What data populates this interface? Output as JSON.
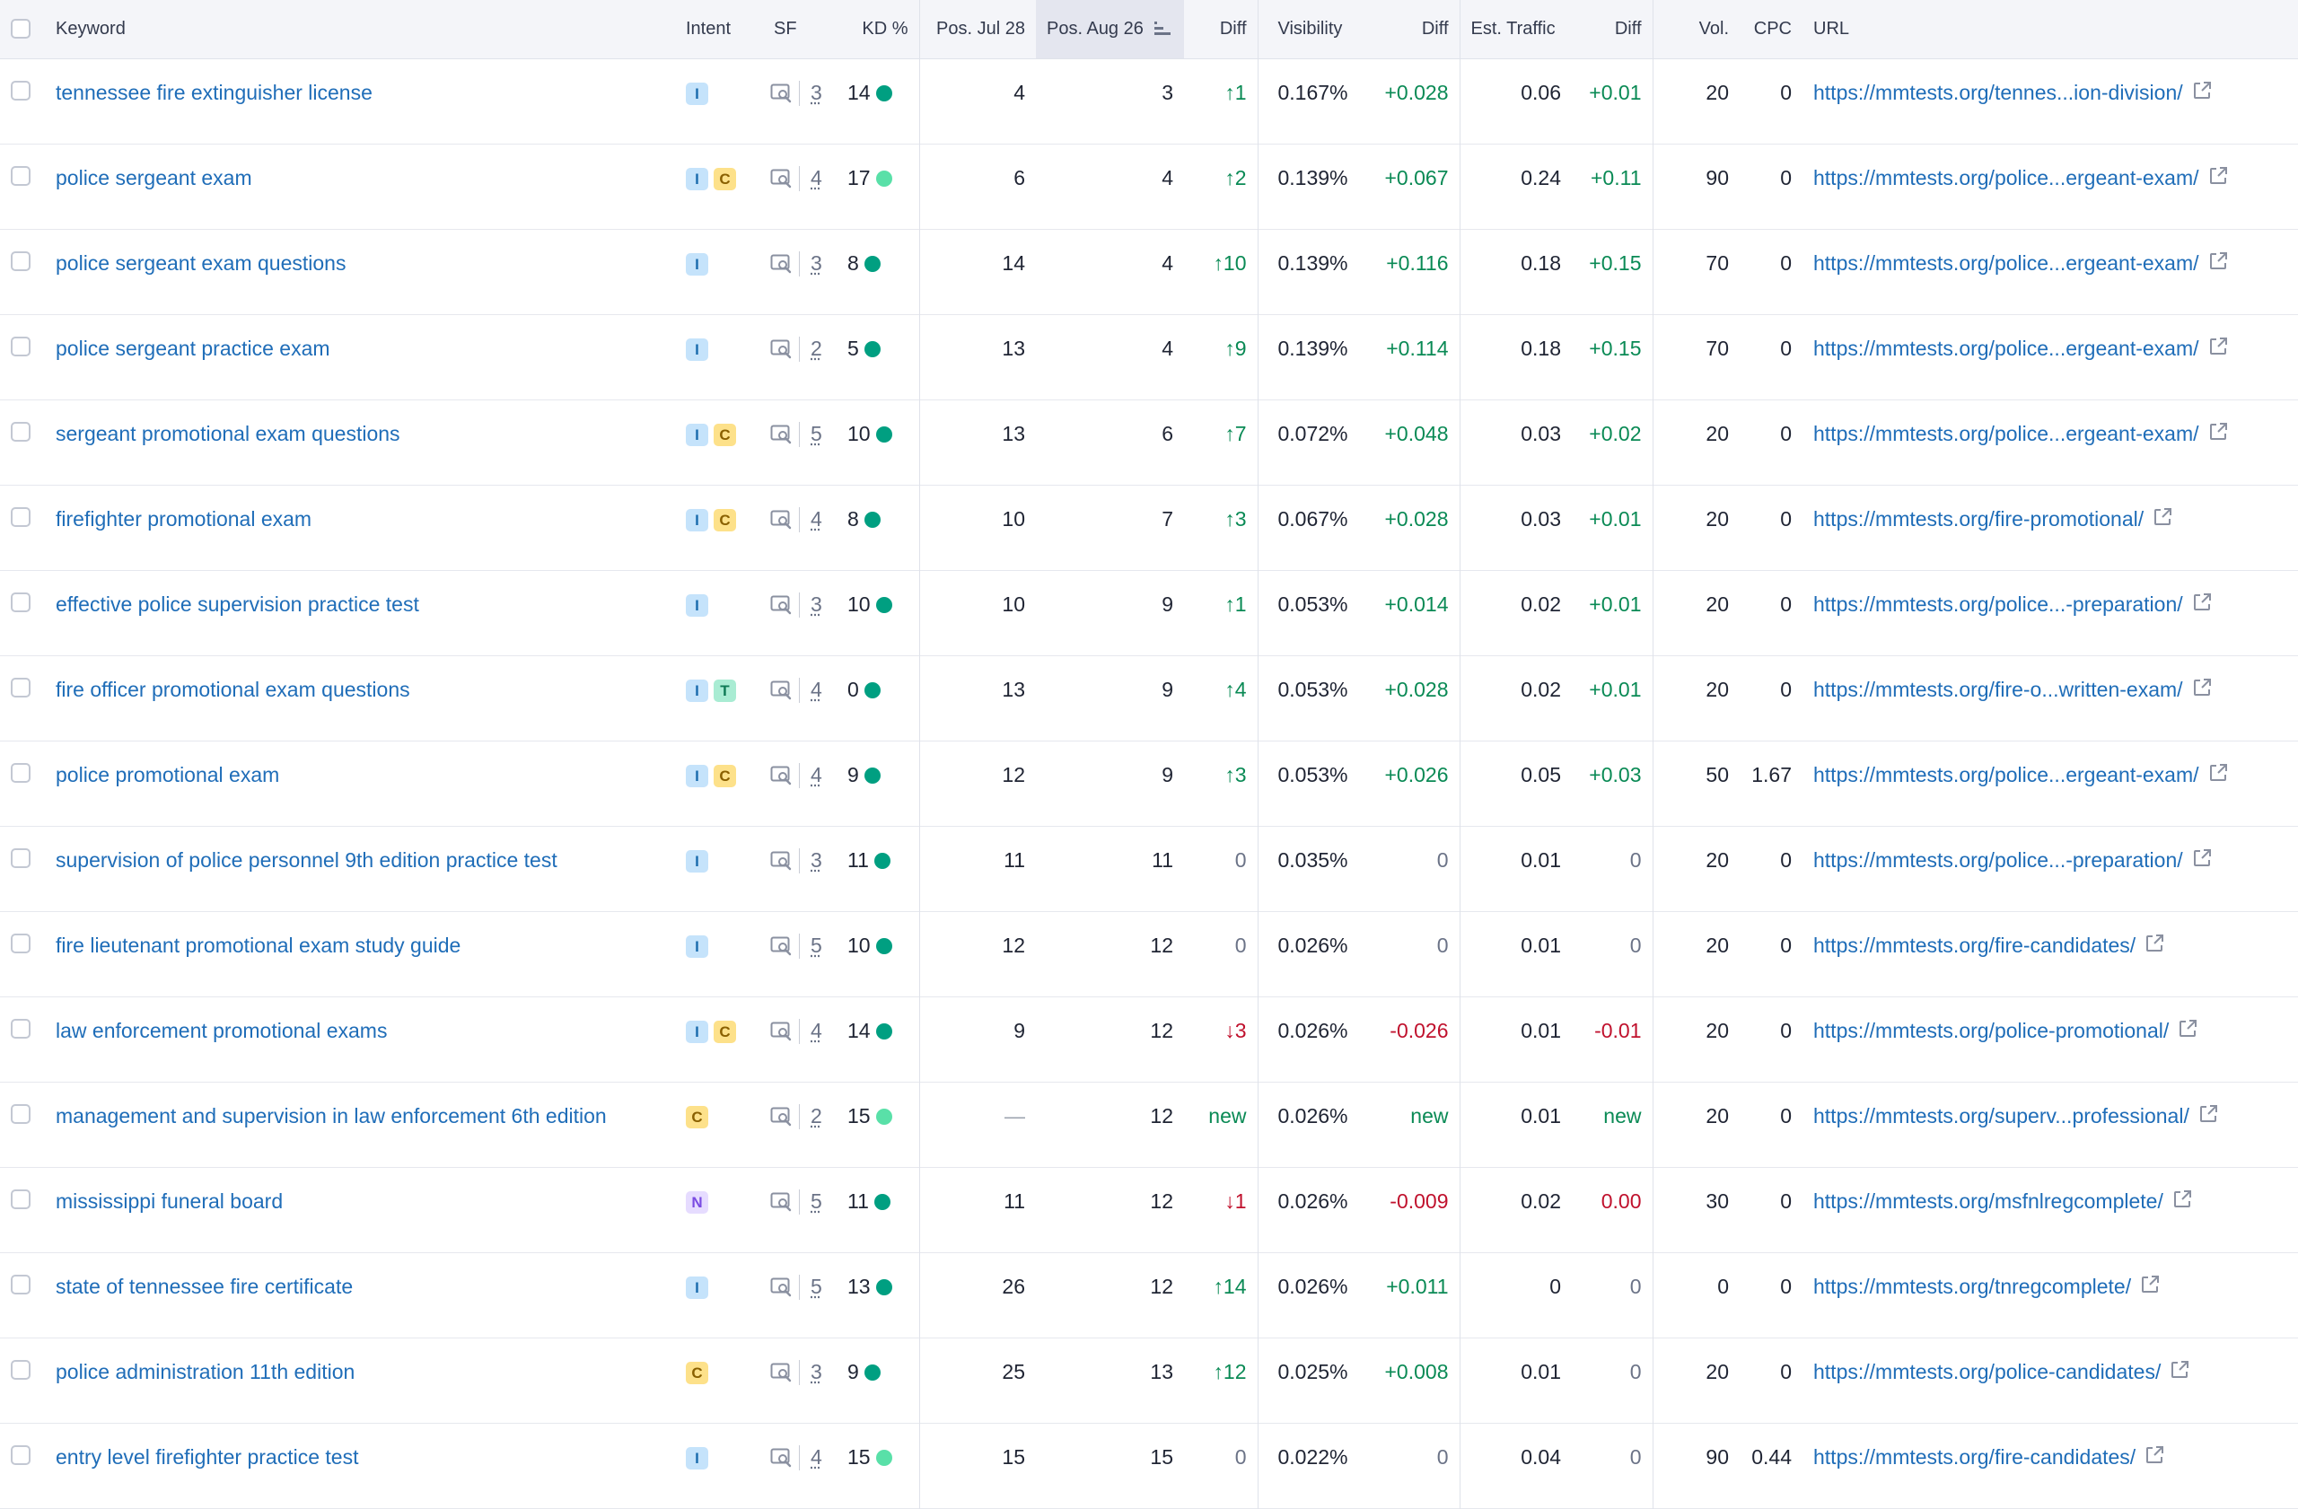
{
  "colors": {
    "link": "#1f6db8",
    "positive": "#0a8a55",
    "negative": "#c0112d",
    "kd_dark": "#009f81",
    "kd_light": "#59e0a8",
    "header_bg": "#f4f5f9"
  },
  "icons": {
    "serp_features": "serp-features-icon",
    "external_link": "external-link-icon",
    "sort": "sort-descending-icon"
  },
  "headers": {
    "keyword": "Keyword",
    "intent": "Intent",
    "sf": "SF",
    "kd": "KD %",
    "pos_prev": "Pos. Jul 28",
    "pos_curr": "Pos. Aug 26",
    "pos_diff": "Diff",
    "visibility": "Visibility",
    "vis_diff": "Diff",
    "traffic": "Est. Traffic",
    "traffic_diff": "Diff",
    "volume": "Vol.",
    "cpc": "CPC",
    "url": "URL"
  },
  "rows": [
    {
      "keyword": "tennessee fire extinguisher license",
      "intents": [
        "I"
      ],
      "sf": "3",
      "kd": "14",
      "kd_level": "dark",
      "pos_prev": "4",
      "pos_curr": "3",
      "pos_diff": "↑1",
      "pos_dir": "up",
      "vis": "0.167%",
      "vis_diff": "+0.028",
      "vis_dir": "up",
      "traffic": "0.06",
      "traffic_diff": "+0.01",
      "traffic_dir": "up",
      "vol": "20",
      "cpc": "0",
      "url": "https://mmtests.org/tennes...ion-division/"
    },
    {
      "keyword": "police sergeant exam",
      "intents": [
        "I",
        "C"
      ],
      "sf": "4",
      "kd": "17",
      "kd_level": "light",
      "pos_prev": "6",
      "pos_curr": "4",
      "pos_diff": "↑2",
      "pos_dir": "up",
      "vis": "0.139%",
      "vis_diff": "+0.067",
      "vis_dir": "up",
      "traffic": "0.24",
      "traffic_diff": "+0.11",
      "traffic_dir": "up",
      "vol": "90",
      "cpc": "0",
      "url": "https://mmtests.org/police...ergeant-exam/"
    },
    {
      "keyword": "police sergeant exam questions",
      "intents": [
        "I"
      ],
      "sf": "3",
      "kd": "8",
      "kd_level": "dark",
      "pos_prev": "14",
      "pos_curr": "4",
      "pos_diff": "↑10",
      "pos_dir": "up",
      "vis": "0.139%",
      "vis_diff": "+0.116",
      "vis_dir": "up",
      "traffic": "0.18",
      "traffic_diff": "+0.15",
      "traffic_dir": "up",
      "vol": "70",
      "cpc": "0",
      "url": "https://mmtests.org/police...ergeant-exam/"
    },
    {
      "keyword": "police sergeant practice exam",
      "intents": [
        "I"
      ],
      "sf": "2",
      "kd": "5",
      "kd_level": "dark",
      "pos_prev": "13",
      "pos_curr": "4",
      "pos_diff": "↑9",
      "pos_dir": "up",
      "vis": "0.139%",
      "vis_diff": "+0.114",
      "vis_dir": "up",
      "traffic": "0.18",
      "traffic_diff": "+0.15",
      "traffic_dir": "up",
      "vol": "70",
      "cpc": "0",
      "url": "https://mmtests.org/police...ergeant-exam/"
    },
    {
      "keyword": "sergeant promotional exam questions",
      "intents": [
        "I",
        "C"
      ],
      "sf": "5",
      "kd": "10",
      "kd_level": "dark",
      "pos_prev": "13",
      "pos_curr": "6",
      "pos_diff": "↑7",
      "pos_dir": "up",
      "vis": "0.072%",
      "vis_diff": "+0.048",
      "vis_dir": "up",
      "traffic": "0.03",
      "traffic_diff": "+0.02",
      "traffic_dir": "up",
      "vol": "20",
      "cpc": "0",
      "url": "https://mmtests.org/police...ergeant-exam/"
    },
    {
      "keyword": "firefighter promotional exam",
      "intents": [
        "I",
        "C"
      ],
      "sf": "4",
      "kd": "8",
      "kd_level": "dark",
      "pos_prev": "10",
      "pos_curr": "7",
      "pos_diff": "↑3",
      "pos_dir": "up",
      "vis": "0.067%",
      "vis_diff": "+0.028",
      "vis_dir": "up",
      "traffic": "0.03",
      "traffic_diff": "+0.01",
      "traffic_dir": "up",
      "vol": "20",
      "cpc": "0",
      "url": "https://mmtests.org/fire-promotional/"
    },
    {
      "keyword": "effective police supervision practice test",
      "intents": [
        "I"
      ],
      "sf": "3",
      "kd": "10",
      "kd_level": "dark",
      "pos_prev": "10",
      "pos_curr": "9",
      "pos_diff": "↑1",
      "pos_dir": "up",
      "vis": "0.053%",
      "vis_diff": "+0.014",
      "vis_dir": "up",
      "traffic": "0.02",
      "traffic_diff": "+0.01",
      "traffic_dir": "up",
      "vol": "20",
      "cpc": "0",
      "url": "https://mmtests.org/police...-preparation/"
    },
    {
      "keyword": "fire officer promotional exam questions",
      "intents": [
        "I",
        "T"
      ],
      "sf": "4",
      "kd": "0",
      "kd_level": "dark",
      "pos_prev": "13",
      "pos_curr": "9",
      "pos_diff": "↑4",
      "pos_dir": "up",
      "vis": "0.053%",
      "vis_diff": "+0.028",
      "vis_dir": "up",
      "traffic": "0.02",
      "traffic_diff": "+0.01",
      "traffic_dir": "up",
      "vol": "20",
      "cpc": "0",
      "url": "https://mmtests.org/fire-o...written-exam/"
    },
    {
      "keyword": "police promotional exam",
      "intents": [
        "I",
        "C"
      ],
      "sf": "4",
      "kd": "9",
      "kd_level": "dark",
      "pos_prev": "12",
      "pos_curr": "9",
      "pos_diff": "↑3",
      "pos_dir": "up",
      "vis": "0.053%",
      "vis_diff": "+0.026",
      "vis_dir": "up",
      "traffic": "0.05",
      "traffic_diff": "+0.03",
      "traffic_dir": "up",
      "vol": "50",
      "cpc": "1.67",
      "url": "https://mmtests.org/police...ergeant-exam/"
    },
    {
      "keyword": "supervision of police personnel 9th edition practice test",
      "intents": [
        "I"
      ],
      "sf": "3",
      "kd": "11",
      "kd_level": "dark",
      "pos_prev": "11",
      "pos_curr": "11",
      "pos_diff": "0",
      "pos_dir": "none",
      "vis": "0.035%",
      "vis_diff": "0",
      "vis_dir": "none",
      "traffic": "0.01",
      "traffic_diff": "0",
      "traffic_dir": "none",
      "vol": "20",
      "cpc": "0",
      "url": "https://mmtests.org/police...-preparation/"
    },
    {
      "keyword": "fire lieutenant promotional exam study guide",
      "intents": [
        "I"
      ],
      "sf": "5",
      "kd": "10",
      "kd_level": "dark",
      "pos_prev": "12",
      "pos_curr": "12",
      "pos_diff": "0",
      "pos_dir": "none",
      "vis": "0.026%",
      "vis_diff": "0",
      "vis_dir": "none",
      "traffic": "0.01",
      "traffic_diff": "0",
      "traffic_dir": "none",
      "vol": "20",
      "cpc": "0",
      "url": "https://mmtests.org/fire-candidates/"
    },
    {
      "keyword": "law enforcement promotional exams",
      "intents": [
        "I",
        "C"
      ],
      "sf": "4",
      "kd": "14",
      "kd_level": "dark",
      "pos_prev": "9",
      "pos_curr": "12",
      "pos_diff": "↓3",
      "pos_dir": "down",
      "vis": "0.026%",
      "vis_diff": "-0.026",
      "vis_dir": "down",
      "traffic": "0.01",
      "traffic_diff": "-0.01",
      "traffic_dir": "down",
      "vol": "20",
      "cpc": "0",
      "url": "https://mmtests.org/police-promotional/"
    },
    {
      "keyword": "management and supervision in law enforcement 6th edition",
      "intents": [
        "C"
      ],
      "sf": "2",
      "kd": "15",
      "kd_level": "light",
      "pos_prev": "—",
      "pos_curr": "12",
      "pos_diff": "new",
      "pos_dir": "up",
      "vis": "0.026%",
      "vis_diff": "new",
      "vis_dir": "up",
      "traffic": "0.01",
      "traffic_diff": "new",
      "traffic_dir": "up",
      "vol": "20",
      "cpc": "0",
      "url": "https://mmtests.org/superv...professional/"
    },
    {
      "keyword": "mississippi funeral board",
      "intents": [
        "N"
      ],
      "sf": "5",
      "kd": "11",
      "kd_level": "dark",
      "pos_prev": "11",
      "pos_curr": "12",
      "pos_diff": "↓1",
      "pos_dir": "down",
      "vis": "0.026%",
      "vis_diff": "-0.009",
      "vis_dir": "down",
      "traffic": "0.02",
      "traffic_diff": "0.00",
      "traffic_dir": "down",
      "vol": "30",
      "cpc": "0",
      "url": "https://mmtests.org/msfnlregcomplete/"
    },
    {
      "keyword": "state of tennessee fire certificate",
      "intents": [
        "I"
      ],
      "sf": "5",
      "kd": "13",
      "kd_level": "dark",
      "pos_prev": "26",
      "pos_curr": "12",
      "pos_diff": "↑14",
      "pos_dir": "up",
      "vis": "0.026%",
      "vis_diff": "+0.011",
      "vis_dir": "up",
      "traffic": "0",
      "traffic_diff": "0",
      "traffic_dir": "none",
      "vol": "0",
      "cpc": "0",
      "url": "https://mmtests.org/tnregcomplete/"
    },
    {
      "keyword": "police administration 11th edition",
      "intents": [
        "C"
      ],
      "sf": "3",
      "kd": "9",
      "kd_level": "dark",
      "pos_prev": "25",
      "pos_curr": "13",
      "pos_diff": "↑12",
      "pos_dir": "up",
      "vis": "0.025%",
      "vis_diff": "+0.008",
      "vis_dir": "up",
      "traffic": "0.01",
      "traffic_diff": "0",
      "traffic_dir": "none",
      "vol": "20",
      "cpc": "0",
      "url": "https://mmtests.org/police-candidates/"
    },
    {
      "keyword": "entry level firefighter practice test",
      "intents": [
        "I"
      ],
      "sf": "4",
      "kd": "15",
      "kd_level": "light",
      "pos_prev": "15",
      "pos_curr": "15",
      "pos_diff": "0",
      "pos_dir": "none",
      "vis": "0.022%",
      "vis_diff": "0",
      "vis_dir": "none",
      "traffic": "0.04",
      "traffic_diff": "0",
      "traffic_dir": "none",
      "vol": "90",
      "cpc": "0.44",
      "url": "https://mmtests.org/fire-candidates/"
    }
  ]
}
